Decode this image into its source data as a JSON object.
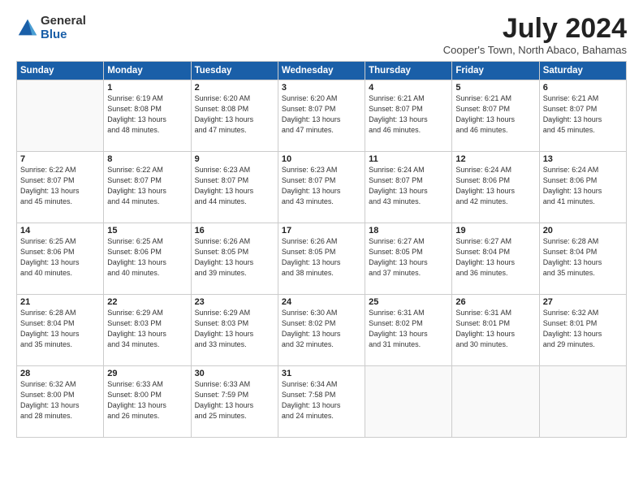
{
  "logo": {
    "general": "General",
    "blue": "Blue"
  },
  "title": "July 2024",
  "subtitle": "Cooper's Town, North Abaco, Bahamas",
  "headers": [
    "Sunday",
    "Monday",
    "Tuesday",
    "Wednesday",
    "Thursday",
    "Friday",
    "Saturday"
  ],
  "weeks": [
    [
      {
        "day": "",
        "info": ""
      },
      {
        "day": "1",
        "info": "Sunrise: 6:19 AM\nSunset: 8:08 PM\nDaylight: 13 hours\nand 48 minutes."
      },
      {
        "day": "2",
        "info": "Sunrise: 6:20 AM\nSunset: 8:08 PM\nDaylight: 13 hours\nand 47 minutes."
      },
      {
        "day": "3",
        "info": "Sunrise: 6:20 AM\nSunset: 8:07 PM\nDaylight: 13 hours\nand 47 minutes."
      },
      {
        "day": "4",
        "info": "Sunrise: 6:21 AM\nSunset: 8:07 PM\nDaylight: 13 hours\nand 46 minutes."
      },
      {
        "day": "5",
        "info": "Sunrise: 6:21 AM\nSunset: 8:07 PM\nDaylight: 13 hours\nand 46 minutes."
      },
      {
        "day": "6",
        "info": "Sunrise: 6:21 AM\nSunset: 8:07 PM\nDaylight: 13 hours\nand 45 minutes."
      }
    ],
    [
      {
        "day": "7",
        "info": "Sunrise: 6:22 AM\nSunset: 8:07 PM\nDaylight: 13 hours\nand 45 minutes."
      },
      {
        "day": "8",
        "info": "Sunrise: 6:22 AM\nSunset: 8:07 PM\nDaylight: 13 hours\nand 44 minutes."
      },
      {
        "day": "9",
        "info": "Sunrise: 6:23 AM\nSunset: 8:07 PM\nDaylight: 13 hours\nand 44 minutes."
      },
      {
        "day": "10",
        "info": "Sunrise: 6:23 AM\nSunset: 8:07 PM\nDaylight: 13 hours\nand 43 minutes."
      },
      {
        "day": "11",
        "info": "Sunrise: 6:24 AM\nSunset: 8:07 PM\nDaylight: 13 hours\nand 43 minutes."
      },
      {
        "day": "12",
        "info": "Sunrise: 6:24 AM\nSunset: 8:06 PM\nDaylight: 13 hours\nand 42 minutes."
      },
      {
        "day": "13",
        "info": "Sunrise: 6:24 AM\nSunset: 8:06 PM\nDaylight: 13 hours\nand 41 minutes."
      }
    ],
    [
      {
        "day": "14",
        "info": "Sunrise: 6:25 AM\nSunset: 8:06 PM\nDaylight: 13 hours\nand 40 minutes."
      },
      {
        "day": "15",
        "info": "Sunrise: 6:25 AM\nSunset: 8:06 PM\nDaylight: 13 hours\nand 40 minutes."
      },
      {
        "day": "16",
        "info": "Sunrise: 6:26 AM\nSunset: 8:05 PM\nDaylight: 13 hours\nand 39 minutes."
      },
      {
        "day": "17",
        "info": "Sunrise: 6:26 AM\nSunset: 8:05 PM\nDaylight: 13 hours\nand 38 minutes."
      },
      {
        "day": "18",
        "info": "Sunrise: 6:27 AM\nSunset: 8:05 PM\nDaylight: 13 hours\nand 37 minutes."
      },
      {
        "day": "19",
        "info": "Sunrise: 6:27 AM\nSunset: 8:04 PM\nDaylight: 13 hours\nand 36 minutes."
      },
      {
        "day": "20",
        "info": "Sunrise: 6:28 AM\nSunset: 8:04 PM\nDaylight: 13 hours\nand 35 minutes."
      }
    ],
    [
      {
        "day": "21",
        "info": "Sunrise: 6:28 AM\nSunset: 8:04 PM\nDaylight: 13 hours\nand 35 minutes."
      },
      {
        "day": "22",
        "info": "Sunrise: 6:29 AM\nSunset: 8:03 PM\nDaylight: 13 hours\nand 34 minutes."
      },
      {
        "day": "23",
        "info": "Sunrise: 6:29 AM\nSunset: 8:03 PM\nDaylight: 13 hours\nand 33 minutes."
      },
      {
        "day": "24",
        "info": "Sunrise: 6:30 AM\nSunset: 8:02 PM\nDaylight: 13 hours\nand 32 minutes."
      },
      {
        "day": "25",
        "info": "Sunrise: 6:31 AM\nSunset: 8:02 PM\nDaylight: 13 hours\nand 31 minutes."
      },
      {
        "day": "26",
        "info": "Sunrise: 6:31 AM\nSunset: 8:01 PM\nDaylight: 13 hours\nand 30 minutes."
      },
      {
        "day": "27",
        "info": "Sunrise: 6:32 AM\nSunset: 8:01 PM\nDaylight: 13 hours\nand 29 minutes."
      }
    ],
    [
      {
        "day": "28",
        "info": "Sunrise: 6:32 AM\nSunset: 8:00 PM\nDaylight: 13 hours\nand 28 minutes."
      },
      {
        "day": "29",
        "info": "Sunrise: 6:33 AM\nSunset: 8:00 PM\nDaylight: 13 hours\nand 26 minutes."
      },
      {
        "day": "30",
        "info": "Sunrise: 6:33 AM\nSunset: 7:59 PM\nDaylight: 13 hours\nand 25 minutes."
      },
      {
        "day": "31",
        "info": "Sunrise: 6:34 AM\nSunset: 7:58 PM\nDaylight: 13 hours\nand 24 minutes."
      },
      {
        "day": "",
        "info": ""
      },
      {
        "day": "",
        "info": ""
      },
      {
        "day": "",
        "info": ""
      }
    ]
  ]
}
